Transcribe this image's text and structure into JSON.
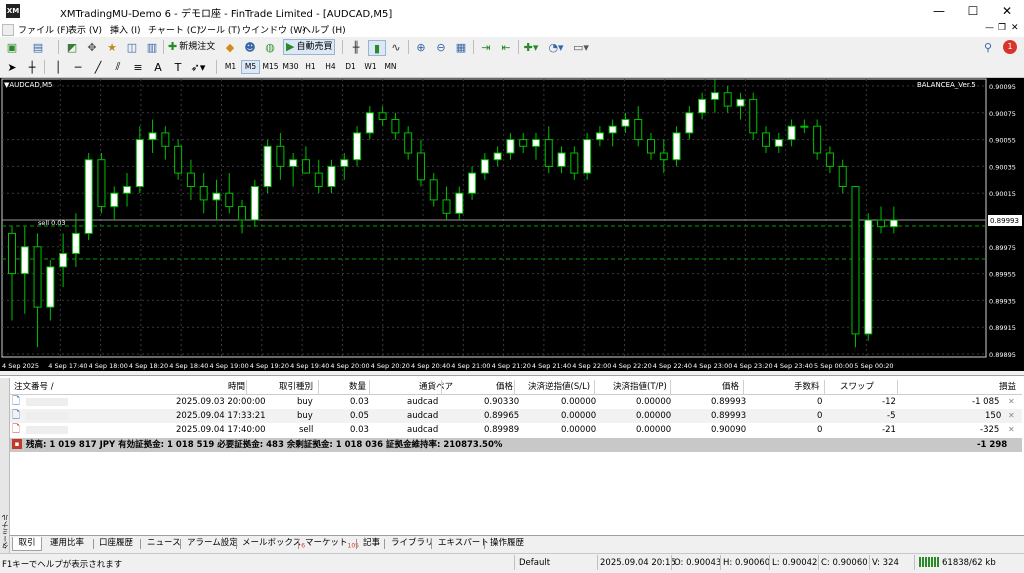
{
  "window": {
    "title": "XMTradingMU-Demo 6 - デモロ座 - FinTrade Limited - [AUDCAD,M5]",
    "icon_label": "XM",
    "minimize": "—",
    "maximize": "☐",
    "close": "✕"
  },
  "menu": [
    "ファイル (F)",
    "表示 (V)",
    "挿入 (I)",
    "チャート (C)",
    "ツール (T)",
    "ウインドウ (W)",
    "ヘルプ (H)"
  ],
  "toolbar": {
    "new_order": "新規注文",
    "auto_trade": "自動売買",
    "notification_count": "1"
  },
  "timeframes": [
    "M1",
    "M5",
    "M15",
    "M30",
    "H1",
    "H4",
    "D1",
    "W1",
    "MN"
  ],
  "selected_timeframe": "M5",
  "chart": {
    "symbol_label": "▼AUDCAD,M5",
    "ea_label": "BALANCEA_Ver.5",
    "current_price": "0.89993",
    "order_label": "sell 0.03"
  },
  "chart_data": {
    "type": "candlestick",
    "symbol": "AUDCAD",
    "timeframe": "M5",
    "price_ticks": [
      "0.90095",
      "0.90075",
      "0.90055",
      "0.90035",
      "0.90015",
      "0.89995",
      "0.89975",
      "0.89955",
      "0.89935",
      "0.89915",
      "0.89895"
    ],
    "time_ticks": [
      "4 Sep 2025",
      "4 Sep 17:40",
      "4 Sep 18:00",
      "4 Sep 18:20",
      "4 Sep 18:40",
      "4 Sep 19:00",
      "4 Sep 19:20",
      "4 Sep 19:40",
      "4 Sep 20:00",
      "4 Sep 20:20",
      "4 Sep 20:40",
      "4 Sep 21:00",
      "4 Sep 21:20",
      "4 Sep 21:40",
      "4 Sep 22:00",
      "4 Sep 22:20",
      "4 Sep 22:40",
      "4 Sep 23:00",
      "4 Sep 23:20",
      "4 Sep 23:40",
      "5 Sep 00:00",
      "5 Sep 00:20"
    ],
    "last_price": 0.89993,
    "colors": {
      "background": "#000000",
      "bull": "#ffffff",
      "bear": "#000000",
      "wick": "#00c000",
      "grid": "#3a3a3a",
      "text": "#ffffff"
    }
  },
  "terminal": {
    "side_label": "ターミナル",
    "headers": [
      "注文番号 /",
      "時間",
      "取引種別",
      "数量",
      "通貨ペア",
      "価格",
      "決済逆指値(S/L)",
      "決済指値(T/P)",
      "価格",
      "手数料",
      "スワップ",
      "損益"
    ],
    "rows": [
      {
        "ticket": "",
        "time": "2025.09.03 20:00:00",
        "type": "buy",
        "volume": "0.03",
        "symbol": "audcad",
        "price": "0.90330",
        "sl": "0.00000",
        "tp": "0.00000",
        "current": "0.89993",
        "commission": "0",
        "swap": "-12",
        "profit": "-1 085"
      },
      {
        "ticket": "",
        "time": "2025.09.04 17:33:21",
        "type": "buy",
        "volume": "0.05",
        "symbol": "audcad",
        "price": "0.89965",
        "sl": "0.00000",
        "tp": "0.00000",
        "current": "0.89993",
        "commission": "0",
        "swap": "-5",
        "profit": "150"
      },
      {
        "ticket": "",
        "time": "2025.09.04 17:40:00",
        "type": "sell",
        "volume": "0.03",
        "symbol": "audcad",
        "price": "0.89989",
        "sl": "0.00000",
        "tp": "0.00000",
        "current": "0.90090",
        "commission": "0",
        "swap": "-21",
        "profit": "-325"
      }
    ],
    "summary": "残高: 1 019 817 JPY  有効証拠金: 1 018 519  必要証拠金: 483  余剰証拠金: 1 018 036  証拠金維持率: 210873.50%",
    "summary_total": "-1 298"
  },
  "tabs": [
    {
      "label": "取引",
      "badge": ""
    },
    {
      "label": "運用比率",
      "badge": ""
    },
    {
      "label": "口座履歴",
      "badge": ""
    },
    {
      "label": "ニュース",
      "badge": ""
    },
    {
      "label": "アラーム設定",
      "badge": ""
    },
    {
      "label": "メールボックス",
      "badge": "6"
    },
    {
      "label": "マーケット",
      "badge": "105"
    },
    {
      "label": "記事",
      "badge": ""
    },
    {
      "label": "ライブラリ",
      "badge": ""
    },
    {
      "label": "エキスパート",
      "badge": ""
    },
    {
      "label": "操作履歴",
      "badge": ""
    }
  ],
  "status": {
    "help": "F1キーでヘルプが表示されます",
    "profile": "Default",
    "datetime": "2025.09.04 20:15",
    "open": "O: 0.90043",
    "high": "H: 0.90060",
    "low": "L: 0.90042",
    "close": "C: 0.90060",
    "volume": "V: 324",
    "traffic": "61838/62 kb"
  }
}
